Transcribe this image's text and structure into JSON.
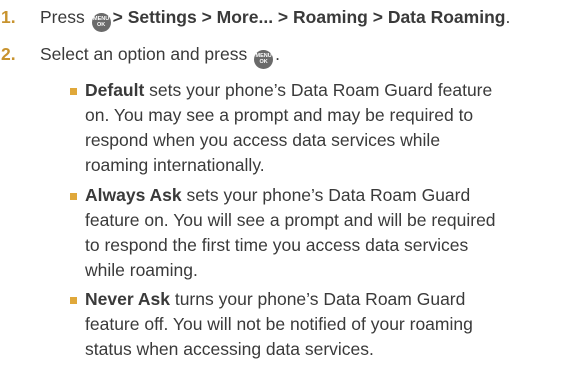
{
  "step1": {
    "number": "1.",
    "prefix": "Press",
    "key_icon_top": "MENU",
    "key_icon_bottom": "OK",
    "path": "> Settings > More... > Roaming > Data Roaming",
    "suffix": "."
  },
  "step2": {
    "number": "2.",
    "text": "Select an option and press",
    "suffix": "."
  },
  "options": [
    {
      "lead": "Default",
      "lines": [
        " sets your phone’s Data Roam Guard feature",
        "on. You may see a prompt and may be required to",
        "respond when you access data services while",
        "roaming internationally."
      ]
    },
    {
      "lead": "Always Ask",
      "lines": [
        " sets your phone’s Data Roam Guard",
        "feature on. You will see a prompt and will be required",
        "to respond the first time you access data services",
        "while roaming."
      ]
    },
    {
      "lead": "Never Ask",
      "lines": [
        " turns your phone’s Data Roam Guard",
        "feature off. You will not be notified of your roaming",
        "status when accessing data services."
      ]
    }
  ],
  "colors": {
    "accent": "#c8932e",
    "bullet": "#e0a83a",
    "text": "#3a3a3a",
    "key_icon": "#6a6a6a"
  }
}
